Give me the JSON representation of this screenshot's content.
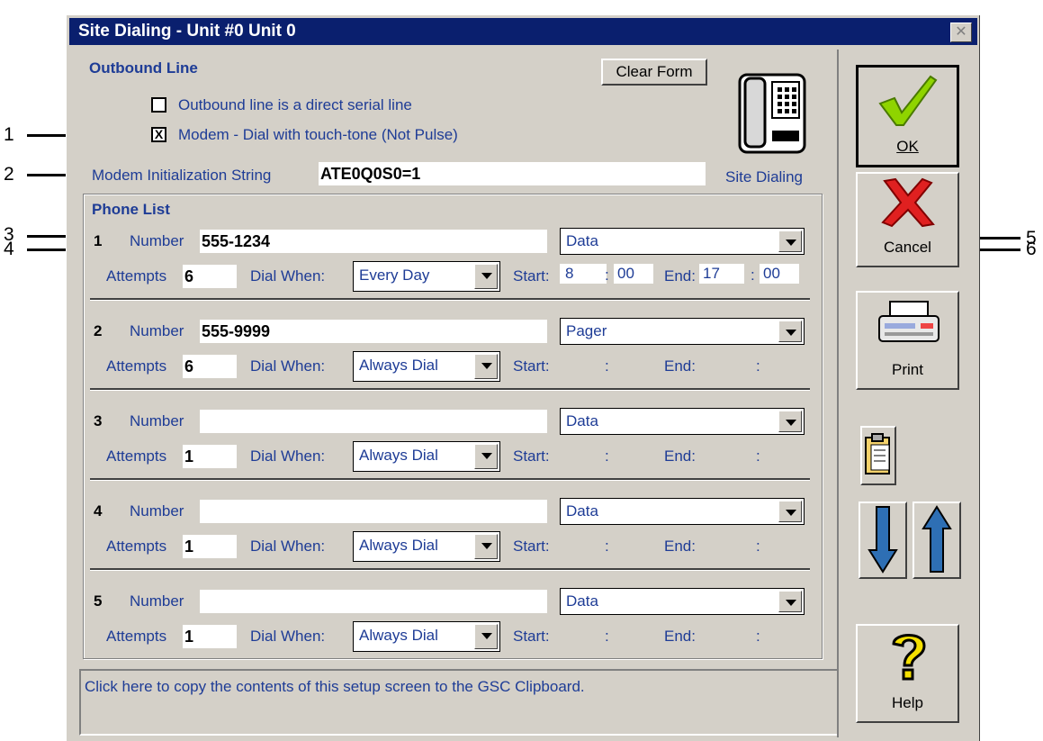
{
  "window": {
    "title": "Site Dialing - Unit #0 Unit 0",
    "close_label": "✕"
  },
  "outbound": {
    "header": "Outbound Line",
    "clear_form": "Clear Form",
    "serial_label": "Outbound line is a direct serial line",
    "serial_checked": false,
    "modem_label": "Modem - Dial with touch-tone (Not Pulse)",
    "modem_checked": true,
    "modem_check_mark": "X",
    "init_label": "Modem Initialization String",
    "init_value": "ATE0Q0S0=1",
    "site_dialing_label": "Site Dialing"
  },
  "phone_list": {
    "header": "Phone List",
    "number_label": "Number",
    "attempts_label": "Attempts",
    "dial_when_label": "Dial When:",
    "start_label": "Start:",
    "end_label": "End:",
    "colon": ":",
    "rows": [
      {
        "index": "1",
        "number": "555-1234",
        "type": "Data",
        "attempts": "6",
        "dial_when": "Every Day",
        "start_h": "8",
        "start_m": "00",
        "end_h": "17",
        "end_m": "00"
      },
      {
        "index": "2",
        "number": "555-9999",
        "type": "Pager",
        "attempts": "6",
        "dial_when": "Always Dial"
      },
      {
        "index": "3",
        "number": "",
        "type": "Data",
        "attempts": "1",
        "dial_when": "Always Dial"
      },
      {
        "index": "4",
        "number": "",
        "type": "Data",
        "attempts": "1",
        "dial_when": "Always Dial"
      },
      {
        "index": "5",
        "number": "",
        "type": "Data",
        "attempts": "1",
        "dial_when": "Always Dial"
      }
    ]
  },
  "status_text": "Click here to copy the contents of this setup screen to the GSC Clipboard.",
  "side_buttons": {
    "ok": "OK",
    "cancel": "Cancel",
    "print": "Print",
    "help": "Help"
  },
  "callouts": [
    "1",
    "2",
    "3",
    "4",
    "5",
    "6"
  ]
}
